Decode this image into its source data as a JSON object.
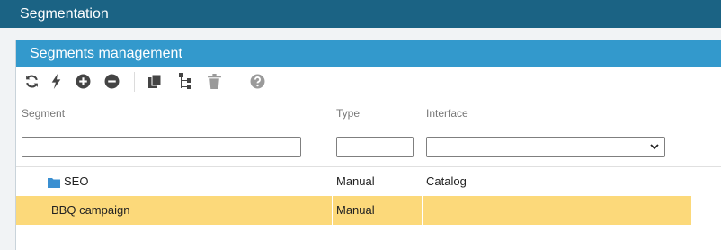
{
  "window": {
    "title": "Segmentation"
  },
  "panel": {
    "title": "Segments management"
  },
  "toolbar": {
    "buttons": [
      {
        "icon": "refresh-icon"
      },
      {
        "icon": "lightning-icon"
      },
      {
        "icon": "add-circle-icon"
      },
      {
        "icon": "remove-circle-icon"
      },
      {
        "icon": "copy-icon"
      },
      {
        "icon": "tree-icon"
      },
      {
        "icon": "trash-icon"
      },
      {
        "icon": "help-icon"
      }
    ]
  },
  "grid": {
    "columns": [
      {
        "label": "Segment"
      },
      {
        "label": "Type"
      },
      {
        "label": "Interface"
      }
    ],
    "filters": {
      "segment": "",
      "type": "",
      "interface": ""
    },
    "rows": [
      {
        "segment": "SEO",
        "type": "Manual",
        "interface": "Catalog",
        "is_folder": true,
        "selected": false
      },
      {
        "segment": "BBQ campaign",
        "type": "Manual",
        "interface": "",
        "is_folder": false,
        "selected": true
      }
    ]
  },
  "colors": {
    "title_bar": "#1b6384",
    "panel_header": "#3399cc",
    "selected_row": "#fcd97a",
    "folder": "#3a8fd1"
  }
}
